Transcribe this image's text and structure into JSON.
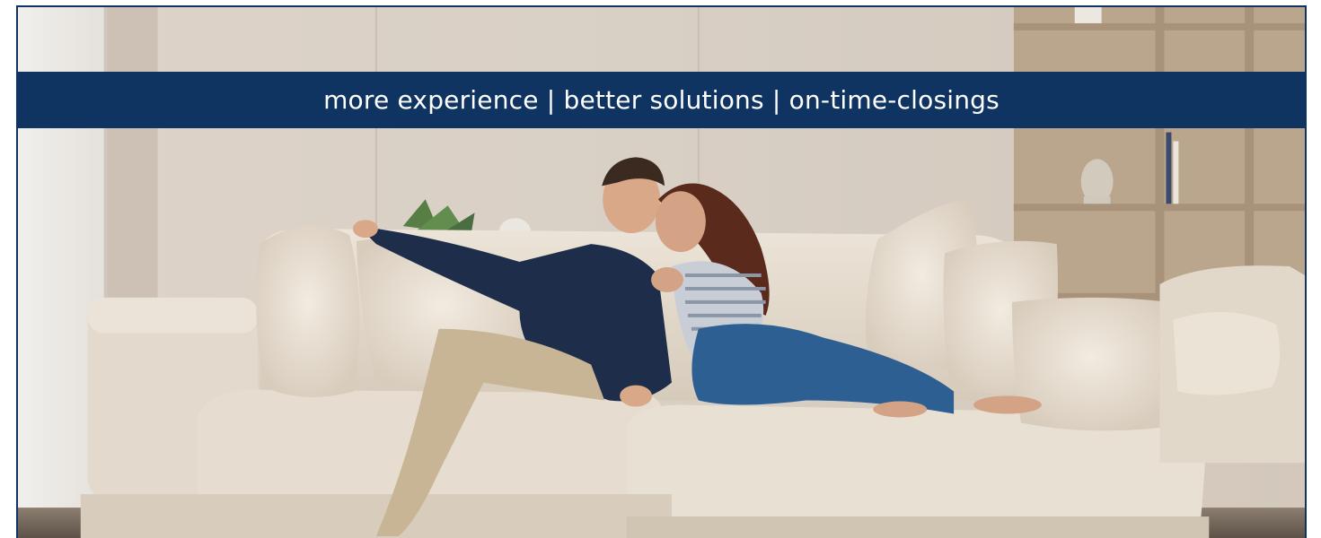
{
  "banner": {
    "tagline": "more experience | better solutions | on-time-closings"
  },
  "photo": {
    "description_icon": "couple-on-sofa-photo"
  },
  "colors": {
    "banner_background": "#0f3461",
    "banner_text": "#ffffff",
    "frame_border": "#0f3461"
  }
}
